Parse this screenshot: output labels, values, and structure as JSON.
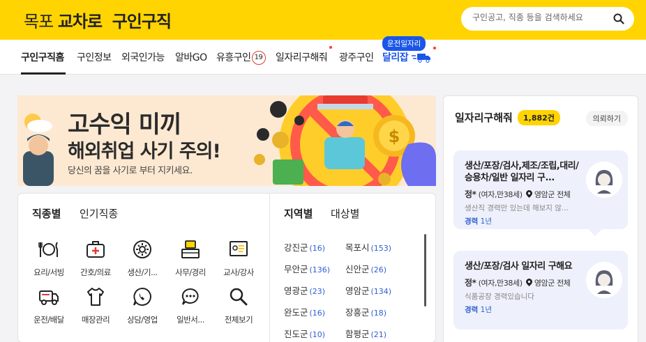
{
  "header": {
    "brand_prefix": "목포",
    "brand_bold": "교차로",
    "brand_suffix": "구인구직",
    "search_placeholder": "구인공고, 직종 등을 검색하세요"
  },
  "nav": {
    "items": [
      "구인구직홈",
      "구인정보",
      "외국인가능",
      "알바GO",
      "유흥구인",
      "일자리구해줘",
      "광주구인",
      "달리잡"
    ],
    "adult_badge": "19",
    "bubble": "운전일자리"
  },
  "banner": {
    "line1": "고수익 미끼",
    "line2": "해외취업 사기 주의!",
    "sub": "당신의 꿈을 사기로 부터 지키세요."
  },
  "categories": {
    "tabs": [
      "직종별",
      "인기직종"
    ],
    "items": [
      {
        "label": "요리/서빙",
        "icon": "dining-icon"
      },
      {
        "label": "간호/의료",
        "icon": "medical-kit-icon"
      },
      {
        "label": "생산/기...",
        "icon": "gear-icon"
      },
      {
        "label": "사무/경리",
        "icon": "office-desk-icon"
      },
      {
        "label": "교사/강사",
        "icon": "teacher-board-icon"
      },
      {
        "label": "운전/배달",
        "icon": "truck-icon"
      },
      {
        "label": "매장관리",
        "icon": "shirt-icon"
      },
      {
        "label": "상담/영업",
        "icon": "phone-chat-icon"
      },
      {
        "label": "일반서...",
        "icon": "chat-bubble-icon"
      },
      {
        "label": "전체보기",
        "icon": "search-icon"
      }
    ]
  },
  "regions": {
    "tabs": [
      "지역별",
      "대상별"
    ],
    "items": [
      {
        "name": "강진군",
        "count": "(16)"
      },
      {
        "name": "목포시",
        "count": "(153)"
      },
      {
        "name": "무안군",
        "count": "(136)"
      },
      {
        "name": "신안군",
        "count": "(26)"
      },
      {
        "name": "영광군",
        "count": "(23)"
      },
      {
        "name": "영암군",
        "count": "(134)"
      },
      {
        "name": "완도군",
        "count": "(16)"
      },
      {
        "name": "장흥군",
        "count": "(18)"
      },
      {
        "name": "진도군",
        "count": "(10)"
      },
      {
        "name": "함평군",
        "count": "(21)"
      }
    ]
  },
  "wanted": {
    "title": "일자리구해줘",
    "count": "1,882건",
    "request_button": "의뢰하기",
    "jobs": [
      {
        "title": "생산/포장/검사,제조/조립,대리/승용차/일반 일자리 구...",
        "name": "정*",
        "info": "(여자,만38세)",
        "location": "영암군 전체",
        "desc": "생산직 경력만 있는데 해보지 않...",
        "career_label": "경력",
        "career": "1년"
      },
      {
        "title": "생산/포장/검사 일자리 구해요",
        "name": "정*",
        "info": "(여자,만38세)",
        "location": "영암군 전체",
        "desc": "식품공장 경력있습니다",
        "career_label": "경력",
        "career": "1년"
      }
    ]
  },
  "colors": {
    "brand_yellow": "#ffd400",
    "accent_blue": "#1a56e8",
    "count_blue": "#2f5fd0",
    "alert_red": "#ff3b30"
  }
}
